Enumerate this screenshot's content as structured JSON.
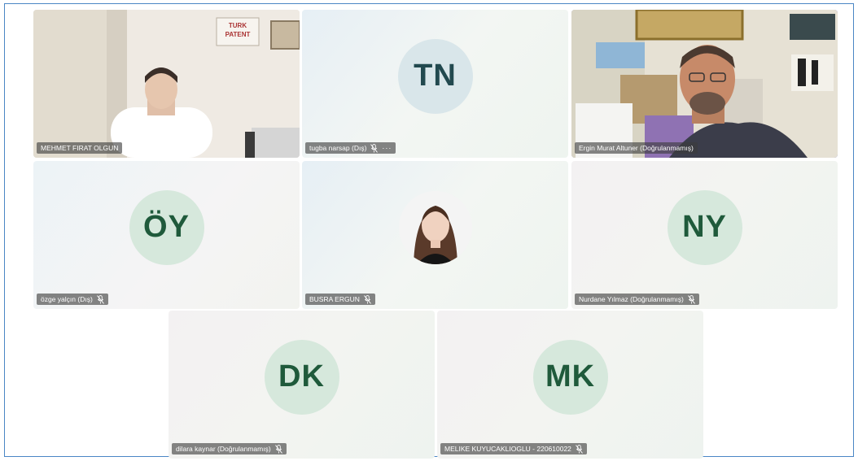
{
  "participants": [
    {
      "name": "MEHMET FIRAT OLGUN",
      "type": "video",
      "muted": false
    },
    {
      "name": "tugba narsap (Dış)",
      "initials": "TN",
      "type": "initials",
      "muted": true,
      "more": "···"
    },
    {
      "name": "Ergin Murat Altuner (Doğrulanmamış)",
      "type": "video",
      "muted": false,
      "active_speaker": true
    },
    {
      "name": "özge yalçın (Dış)",
      "initials": "ÖY",
      "type": "initials",
      "muted": true
    },
    {
      "name": "BUSRA ERGUN",
      "type": "photo",
      "muted": true
    },
    {
      "name": "Nurdane Yılmaz (Doğrulanmamış)",
      "initials": "NY",
      "type": "initials",
      "muted": true
    },
    {
      "name": "dilara kaynar (Doğrulanmamış)",
      "initials": "DK",
      "type": "initials",
      "muted": true
    },
    {
      "name": "MELIKE KUYUCAKLIOGLU - 220610022",
      "initials": "MK",
      "type": "initials",
      "muted": true
    }
  ],
  "colors": {
    "frame_border": "#4a86c5",
    "active_border": "#5b5fc7",
    "avatar_green_bg": "#d6e8dc",
    "avatar_green_text": "#1f5a3b",
    "avatar_blue_bg": "#d9e6ea",
    "avatar_blue_text": "#22494f"
  },
  "icons": {
    "mute": "mic-off-icon",
    "more": "more-options-icon"
  }
}
